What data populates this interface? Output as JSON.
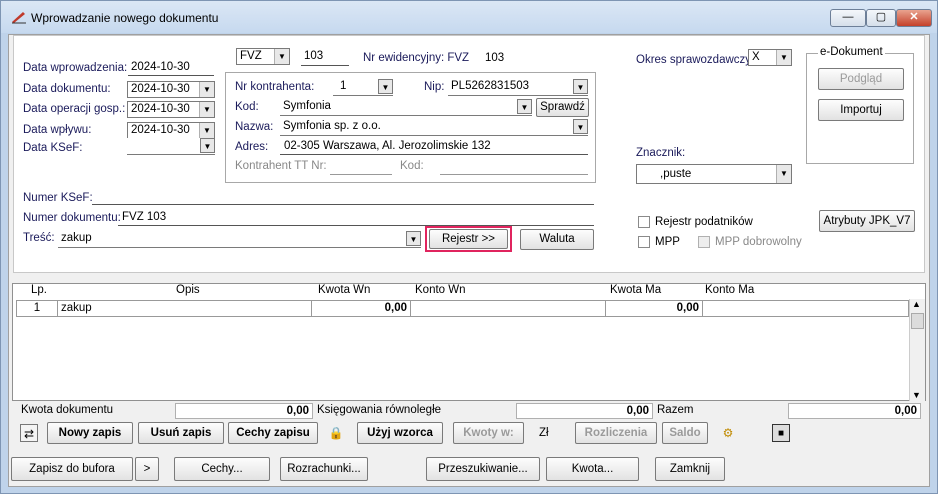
{
  "window": {
    "title": "Wprowadzanie nowego dokumentu"
  },
  "dates": [
    {
      "label": "Data wprowadzenia:",
      "value": "2024-10-30"
    },
    {
      "label": "Data dokumentu:",
      "value": "2024-10-30"
    },
    {
      "label": "Data operacji gosp.:",
      "value": "2024-10-30"
    },
    {
      "label": "Data wpływu:",
      "value": "2024-10-30"
    },
    {
      "label": "Data KSeF:",
      "value": ""
    }
  ],
  "doc": {
    "type": "FVZ",
    "number": "103",
    "ewid_label": "Nr ewidencyjny: FVZ",
    "ewid_num": "103"
  },
  "contractor": {
    "nr_label": "Nr kontrahenta:",
    "nr": "1",
    "nip_label": "Nip:",
    "nip": "PL5262831503",
    "kod_label": "Kod:",
    "kod": "Symfonia",
    "check_btn": "Sprawdź",
    "nazwa_label": "Nazwa:",
    "nazwa": "Symfonia sp. z o.o.",
    "adres_label": "Adres:",
    "adres": "02-305 Warszawa, Al. Jerozolimskie 132",
    "tt_label": "Kontrahent TT Nr:",
    "tt_kod_label": "Kod:"
  },
  "ksef_label": "Numer KSeF:",
  "numdok_label": "Numer dokumentu:",
  "numdok": "FVZ 103",
  "tresc_label": "Treść:",
  "tresc": "zakup",
  "rejestr_btn": "Rejestr >>",
  "waluta_btn": "Waluta",
  "okres": {
    "label": "Okres sprawozdawczy:",
    "value": "X"
  },
  "edoc": {
    "title": "e-Dokument",
    "podglad": "Podgląd",
    "importuj": "Importuj"
  },
  "znacznik": {
    "label": "Znacznik:",
    "value": ",puste"
  },
  "checks": {
    "rejestr": "Rejestr podatników",
    "mpp": "MPP",
    "mpp_dobr": "MPP dobrowolny"
  },
  "jpk_btn": "Atrybuty JPK_V7",
  "grid": {
    "headers": [
      "Lp.",
      "Opis",
      "Kwota Wn",
      "Konto Wn",
      "Kwota Ma",
      "Konto Ma"
    ],
    "rows": [
      {
        "lp": "1",
        "opis": "zakup",
        "kwota_wn": "0,00",
        "konto_wn": "",
        "kwota_ma": "0,00",
        "konto_ma": ""
      }
    ]
  },
  "totals": {
    "kwota_label": "Kwota dokumentu",
    "kwota": "0,00",
    "ksieg_label": "Księgowania równoległe",
    "ksieg": "0,00",
    "razem_label": "Razem",
    "razem": "0,00"
  },
  "toolbar": {
    "nowy": "Nowy zapis",
    "usun": "Usuń zapis",
    "cechy": "Cechy zapisu",
    "uzyj": "Użyj wzorca",
    "kwoty": "Kwoty w:",
    "currency": "Zł",
    "rozliczenia": "Rozliczenia",
    "saldo": "Saldo"
  },
  "bottom": {
    "zapisz": "Zapisz do bufora",
    "more": ">",
    "cechy": "Cechy...",
    "rozrachunki": "Rozrachunki...",
    "przeszukiwanie": "Przeszukiwanie...",
    "kwota": "Kwota...",
    "zamknij": "Zamknij"
  }
}
